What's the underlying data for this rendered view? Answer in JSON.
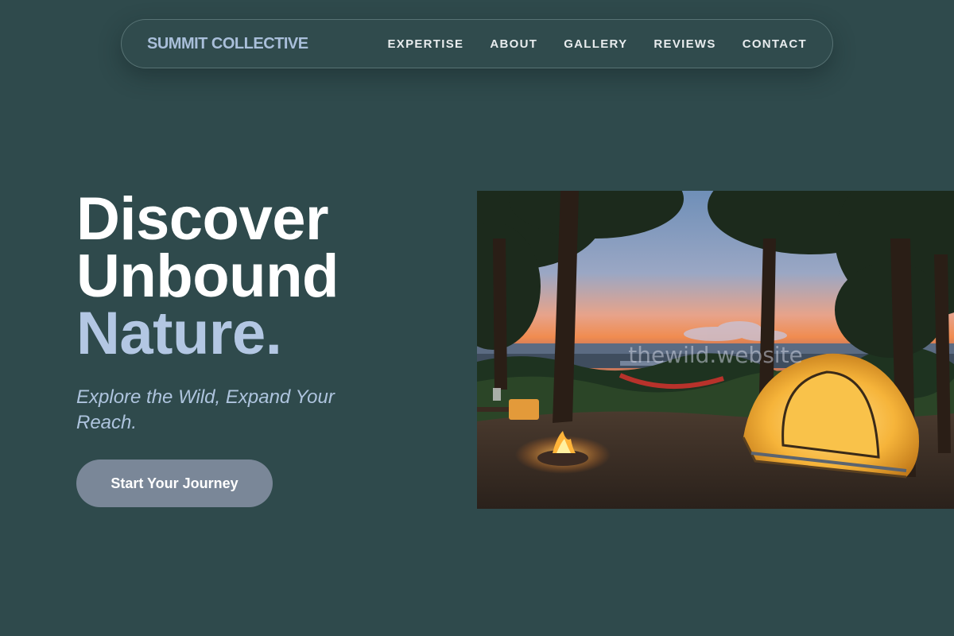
{
  "nav": {
    "brand": "SUMMIT COLLECTIVE",
    "links": [
      "EXPERTISE",
      "ABOUT",
      "GALLERY",
      "REVIEWS",
      "CONTACT"
    ]
  },
  "hero": {
    "headline_line1": "Discover",
    "headline_line2": "Unbound",
    "headline_line3": "Nature.",
    "tagline": "Explore the Wild, Expand Your Reach.",
    "cta_label": "Start Your Journey"
  },
  "photo": {
    "watermark": "thewild.website"
  },
  "colors": {
    "background": "#2f4a4c",
    "brand": "#a9bfda",
    "accent": "#b3c7e3",
    "cta": "#7a8798"
  }
}
